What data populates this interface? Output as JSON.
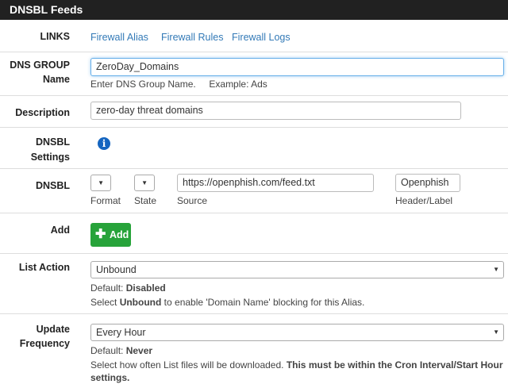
{
  "panel": {
    "title": "DNSBL Feeds"
  },
  "links": {
    "label": "LINKS",
    "items": [
      "Firewall Alias",
      "Firewall Rules",
      "Firewall Logs"
    ]
  },
  "dns_group": {
    "label_line1": "DNS GROUP",
    "label_line2": "Name",
    "value": "ZeroDay_Domains",
    "help": "Enter DNS Group Name.     Example: Ads"
  },
  "description": {
    "label": "Description",
    "value": "zero-day threat domains"
  },
  "dnsbl_settings": {
    "label_line1": "DNSBL",
    "label_line2": "Settings",
    "icon": "info-icon"
  },
  "dnsbl": {
    "label": "DNSBL",
    "format_label": "Format",
    "state_label": "State",
    "source_value": "https://openphish.com/feed.txt",
    "source_label": "Source",
    "header_value": "Openphish",
    "header_label": "Header/Label"
  },
  "add": {
    "label": "Add",
    "button": "Add",
    "icon": "plus-icon"
  },
  "list_action": {
    "label": "List Action",
    "selected": "Unbound",
    "default_prefix": "Default: ",
    "default_value": "Disabled",
    "help_prefix": "Select ",
    "help_bold": "Unbound",
    "help_suffix": " to enable 'Domain Name' blocking for this Alias."
  },
  "update_frequency": {
    "label_line1": "Update",
    "label_line2": "Frequency",
    "selected": "Every Hour",
    "default_prefix": "Default: ",
    "default_value": "Never",
    "help_prefix": "Select how often List files will be downloaded. ",
    "help_bold": "This must be within the Cron Interval/Start Hour settings."
  },
  "colors": {
    "header_bg": "#212121",
    "link": "#337ab7",
    "add_button": "#27a33a",
    "info_icon": "#1565c0"
  }
}
